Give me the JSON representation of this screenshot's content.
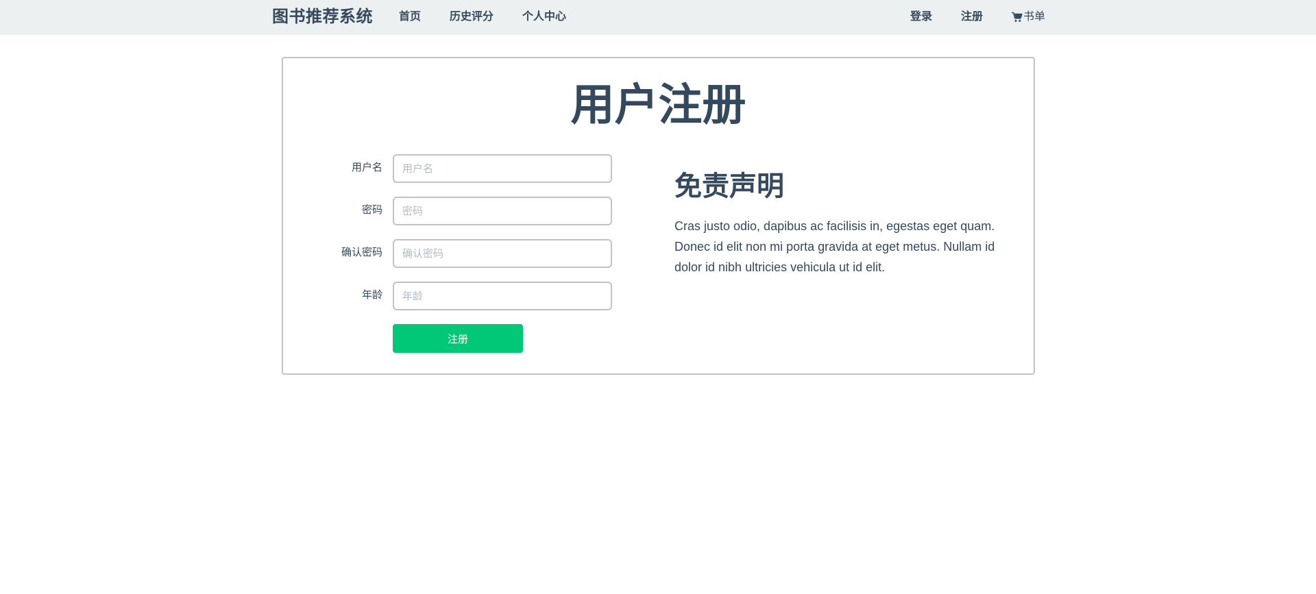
{
  "navbar": {
    "brand": "图书推荐系统",
    "links": {
      "home": "首页",
      "history": "历史评分",
      "personal": "个人中心",
      "login": "登录",
      "register": "注册",
      "cart": "书单"
    },
    "cart_icon": "cart-icon"
  },
  "page": {
    "title": "用户注册"
  },
  "form": {
    "username": {
      "label": "用户名",
      "placeholder": "用户名",
      "value": ""
    },
    "password": {
      "label": "密码",
      "placeholder": "密码",
      "value": ""
    },
    "confirm": {
      "label": "确认密码",
      "placeholder": "确认密码",
      "value": ""
    },
    "age": {
      "label": "年龄",
      "placeholder": "年龄",
      "value": ""
    },
    "submit_label": "注册",
    "submit_color": "#00c876"
  },
  "disclaimer": {
    "title": "免责声明",
    "text": "Cras justo odio, dapibus ac facilisis in, egestas eget quam. Donec id elit non mi porta gravida at eget metus. Nullam id dolor id nibh ultricies vehicula ut id elit."
  },
  "colors": {
    "navbar_bg": "#ecf0f1",
    "text": "#34495e",
    "border": "#bdc3c7"
  }
}
